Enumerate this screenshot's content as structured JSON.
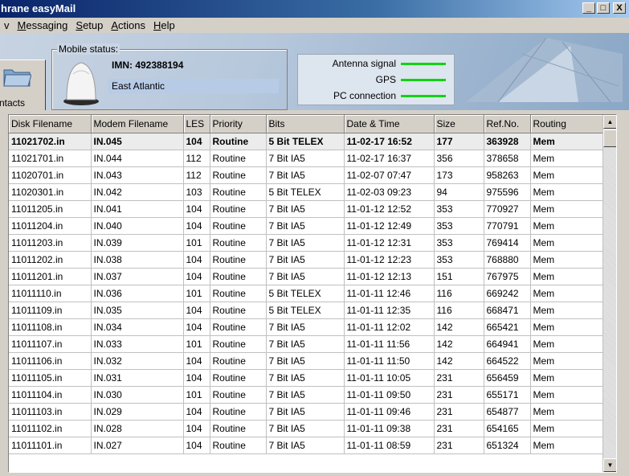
{
  "window": {
    "title": "hrane easyMail",
    "min": "_",
    "max": "□",
    "close": "X"
  },
  "menu": {
    "items": [
      {
        "label": "v",
        "underline": ""
      },
      {
        "label": "Messaging",
        "underline": "M"
      },
      {
        "label": "Setup",
        "underline": "S"
      },
      {
        "label": "Actions",
        "underline": "A"
      },
      {
        "label": "Help",
        "underline": "H"
      }
    ]
  },
  "toolbar": {
    "contacts_label": "ntacts"
  },
  "mobile_status": {
    "legend": "Mobile status:",
    "imn": "IMN: 492388194",
    "region": "East Atlantic"
  },
  "signals": {
    "antenna": "Antenna signal",
    "gps": "GPS",
    "pc": "PC connection",
    "color": "#12d312"
  },
  "table": {
    "columns": [
      "Disk Filename",
      "Modem Filename",
      "LES",
      "Priority",
      "Bits",
      "Date & Time",
      "Size",
      "Ref.No.",
      "Routing"
    ],
    "rows": [
      [
        "11021702.in",
        "IN.045",
        "104",
        "Routine",
        "5 Bit TELEX",
        "11-02-17  16:52",
        "177",
        "363928",
        "Mem"
      ],
      [
        "11021701.in",
        "IN.044",
        "112",
        "Routine",
        "7 Bit IA5",
        "11-02-17  16:37",
        "356",
        "378658",
        "Mem"
      ],
      [
        "11020701.in",
        "IN.043",
        "112",
        "Routine",
        "7 Bit IA5",
        "11-02-07  07:47",
        "173",
        "958263",
        "Mem"
      ],
      [
        "11020301.in",
        "IN.042",
        "103",
        "Routine",
        "5 Bit TELEX",
        "11-02-03  09:23",
        "94",
        "975596",
        "Mem"
      ],
      [
        "11011205.in",
        "IN.041",
        "104",
        "Routine",
        "7 Bit IA5",
        "11-01-12  12:52",
        "353",
        "770927",
        "Mem"
      ],
      [
        "11011204.in",
        "IN.040",
        "104",
        "Routine",
        "7 Bit IA5",
        "11-01-12  12:49",
        "353",
        "770791",
        "Mem"
      ],
      [
        "11011203.in",
        "IN.039",
        "101",
        "Routine",
        "7 Bit IA5",
        "11-01-12  12:31",
        "353",
        "769414",
        "Mem"
      ],
      [
        "11011202.in",
        "IN.038",
        "104",
        "Routine",
        "7 Bit IA5",
        "11-01-12  12:23",
        "353",
        "768880",
        "Mem"
      ],
      [
        "11011201.in",
        "IN.037",
        "104",
        "Routine",
        "7 Bit IA5",
        "11-01-12  12:13",
        "151",
        "767975",
        "Mem"
      ],
      [
        "11011110.in",
        "IN.036",
        "101",
        "Routine",
        "5 Bit TELEX",
        "11-01-11  12:46",
        "116",
        "669242",
        "Mem"
      ],
      [
        "11011109.in",
        "IN.035",
        "104",
        "Routine",
        "5 Bit TELEX",
        "11-01-11  12:35",
        "116",
        "668471",
        "Mem"
      ],
      [
        "11011108.in",
        "IN.034",
        "104",
        "Routine",
        "7 Bit IA5",
        "11-01-11  12:02",
        "142",
        "665421",
        "Mem"
      ],
      [
        "11011107.in",
        "IN.033",
        "101",
        "Routine",
        "7 Bit IA5",
        "11-01-11  11:56",
        "142",
        "664941",
        "Mem"
      ],
      [
        "11011106.in",
        "IN.032",
        "104",
        "Routine",
        "7 Bit IA5",
        "11-01-11  11:50",
        "142",
        "664522",
        "Mem"
      ],
      [
        "11011105.in",
        "IN.031",
        "104",
        "Routine",
        "7 Bit IA5",
        "11-01-11  10:05",
        "231",
        "656459",
        "Mem"
      ],
      [
        "11011104.in",
        "IN.030",
        "101",
        "Routine",
        "7 Bit IA5",
        "11-01-11  09:50",
        "231",
        "655171",
        "Mem"
      ],
      [
        "11011103.in",
        "IN.029",
        "104",
        "Routine",
        "7 Bit IA5",
        "11-01-11  09:46",
        "231",
        "654877",
        "Mem"
      ],
      [
        "11011102.in",
        "IN.028",
        "104",
        "Routine",
        "7 Bit IA5",
        "11-01-11  09:38",
        "231",
        "654165",
        "Mem"
      ],
      [
        "11011101.in",
        "IN.027",
        "104",
        "Routine",
        "7 Bit IA5",
        "11-01-11  08:59",
        "231",
        "651324",
        "Mem"
      ]
    ],
    "bold_row_index": 0
  }
}
